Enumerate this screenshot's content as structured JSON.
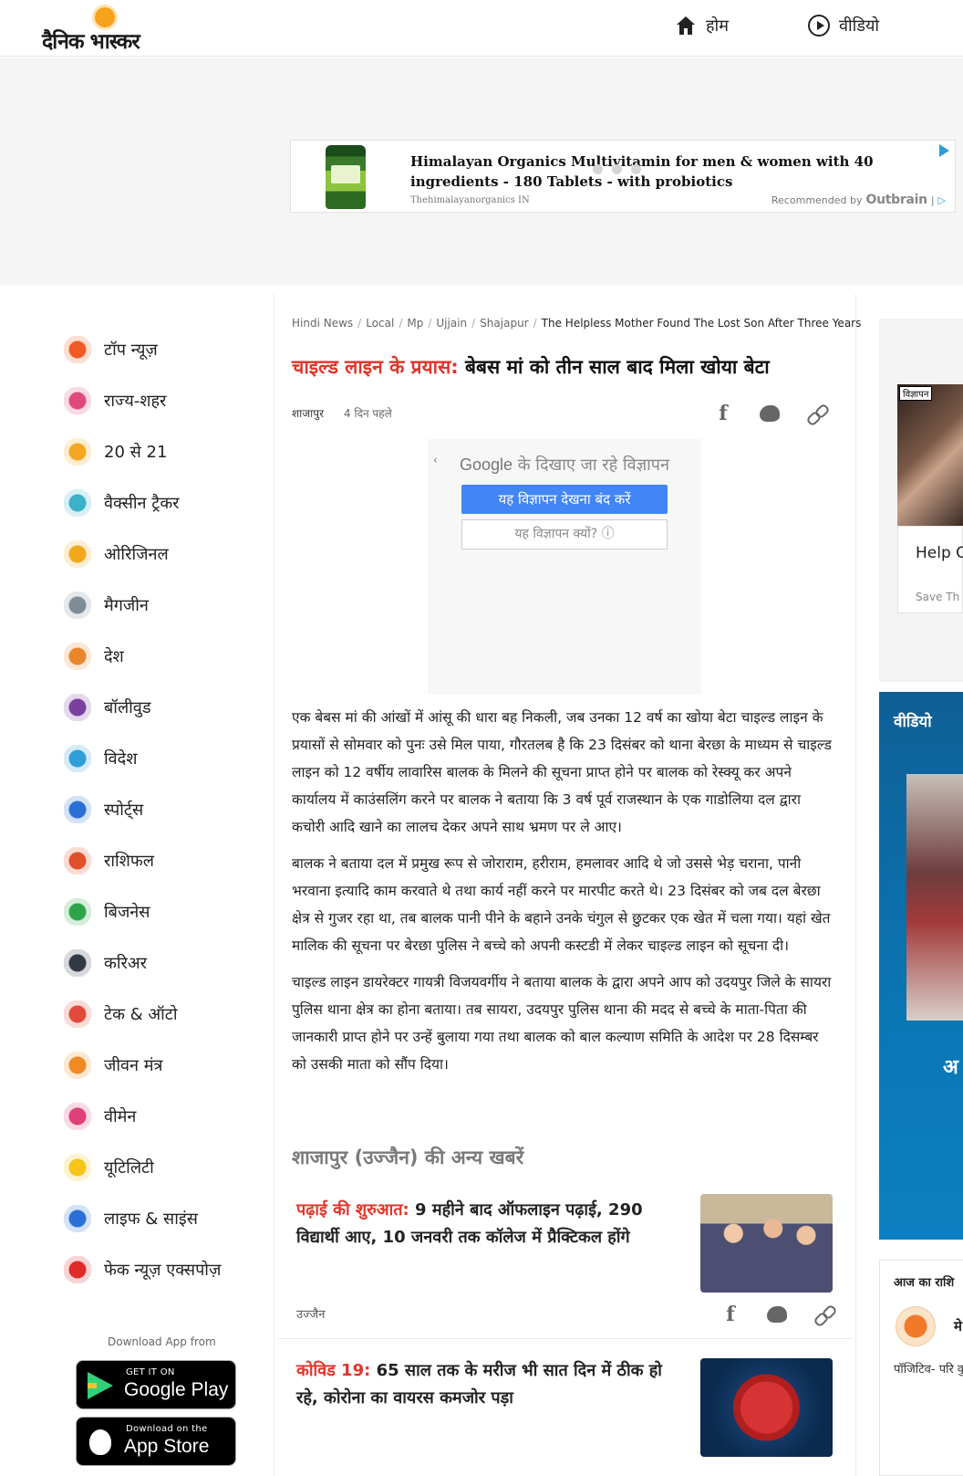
{
  "header": {
    "logo_text": "दैनिक भास्कर",
    "nav": [
      {
        "label": "होम",
        "icon": "home-icon"
      },
      {
        "label": "वीडियो",
        "icon": "play-circle-icon"
      }
    ]
  },
  "top_ad": {
    "title": "Himalayan Organics Multivitamin for men & women with 40 ingredients - 180 Tablets - with probiotics",
    "source": "Thehimalayanorganics IN",
    "recommended_by": "Recommended by",
    "brand": "Outbrain",
    "divider": "|",
    "arrow": "▷"
  },
  "sidebar": {
    "items": [
      {
        "label": "टॉप न्यूज़",
        "icon": "flame-icon",
        "color": "#f15a24"
      },
      {
        "label": "राज्य-शहर",
        "icon": "city-icon",
        "color": "#e04a7a"
      },
      {
        "label": "20 से 21",
        "icon": "sunrise-icon",
        "color": "#f5a623"
      },
      {
        "label": "वैक्सीन ट्रैकर",
        "icon": "syringe-icon",
        "color": "#3bb2c9"
      },
      {
        "label": "ओरिजिनल",
        "icon": "original-badge-icon",
        "color": "#f2a81d"
      },
      {
        "label": "मैगजीन",
        "icon": "magazine-icon",
        "color": "#7e8c99"
      },
      {
        "label": "देश",
        "icon": "india-gate-icon",
        "color": "#e8862d"
      },
      {
        "label": "बॉलीवुड",
        "icon": "clapperboard-icon",
        "color": "#7b3fa0"
      },
      {
        "label": "विदेश",
        "icon": "globe-icon",
        "color": "#2e9fd8"
      },
      {
        "label": "स्पोर्ट्स",
        "icon": "runner-icon",
        "color": "#2a6fd6"
      },
      {
        "label": "राशिफल",
        "icon": "zodiac-icon",
        "color": "#e0502a"
      },
      {
        "label": "बिजनेस",
        "icon": "rupee-coin-icon",
        "color": "#2fa34a"
      },
      {
        "label": "करिअर",
        "icon": "graduation-cap-icon",
        "color": "#333a45"
      },
      {
        "label": "टेक & ऑटो",
        "icon": "car-phone-icon",
        "color": "#e24a3b"
      },
      {
        "label": "जीवन मंत्र",
        "icon": "lotus-lamp-icon",
        "color": "#f08a24"
      },
      {
        "label": "वीमेन",
        "icon": "women-icon",
        "color": "#e0407a"
      },
      {
        "label": "यूटिलिटी",
        "icon": "bulb-icon",
        "color": "#f5c518"
      },
      {
        "label": "लाइफ & साइंस",
        "icon": "dna-icon",
        "color": "#2a6fd6"
      },
      {
        "label": "फेक न्यूज़ एक्सपोज़",
        "icon": "fake-badge-icon",
        "color": "#e02a2a"
      }
    ],
    "download_label": "Download App from",
    "google_play": {
      "small": "GET IT ON",
      "big": "Google Play"
    },
    "app_store": {
      "small": "Download on the",
      "big": "App Store"
    }
  },
  "breadcrumb": [
    "Hindi News",
    "Local",
    "Mp",
    "Ujjain",
    "Shajapur",
    "The Helpless Mother Found The Lost Son After Three Years"
  ],
  "breadcrumb_sep": "/",
  "article": {
    "kicker": "चाइल्ड लाइन के प्रयास:",
    "title": "बेबस मां को तीन साल बाद मिला खोया बेटा",
    "location": "शाजापुर",
    "time": "4 दिन पहले",
    "paragraphs": [
      "एक बेबस मां की आंखों में आंसू की धारा बह निकली, जब उनका 12 वर्ष का खोया बेटा चाइल्ड लाइन के प्रयासों से सोमवार को पुनः उसे मिल पाया, गौरतलब है कि 23 दिसंबर को थाना बेरछा के माध्यम से चाइल्ड लाइन को 12 वर्षीय लावारिस बालक के मिलने की सूचना प्राप्त होने पर बालक को रेस्क्यू कर अपने कार्यालय में काउंसलिंग करने पर बालक ने बताया कि 3 वर्ष पूर्व राजस्थान के एक गाडोलिया दल द्वारा कचोरी आदि खाने का लालच देकर अपने साथ भ्रमण पर ले आए।",
      "बालक ने बताया दल में प्रमुख रूप से जोराराम, हरीराम, हमलावर आदि थे जो उससे भेड़ चराना, पानी भरवाना इत्यादि काम करवाते थे तथा कार्य नहीं करने पर मारपीट करते थे। 23 दिसंबर को जब दल बेरछा क्षेत्र से गुजर रहा था, तब बालक पानी पीने के बहाने उनके चंगुल से छुटकर एक खेत में चला गया। यहां खेत मालिक की सूचना पर बेरछा पुलिस ने बच्चे को अपनी कस्टडी में लेकर चाइल्ड लाइन को सूचना दी।",
      "चाइल्ड लाइन डायरेक्टर गायत्री विजयवर्गीय ने बताया बालक के द्वारा अपने आप को उदयपुर जिले के सायरा पुलिस थाना क्षेत्र का होना बताया। तब सायरा, उदयपुर पुलिस थाना की मदद से बच्चे के माता-पिता की जानकारी प्राप्त होने पर उन्हें बुलाया गया तथा बालक को बाल कल्याण समिति के आदेश पर 28 दिसम्बर को उसकी माता को सौंप दिया।"
    ]
  },
  "google_ad": {
    "back": "‹",
    "brand": "Google",
    "heading": "के दिखाए जा रहे विज्ञापन",
    "stop_button": "यह विज्ञापन देखना बंद करें",
    "why_button": "यह विज्ञापन क्यों? ⓘ"
  },
  "more_news_title": "शाजापुर (उज्जैन) की अन्य खबरें",
  "more_news": [
    {
      "kicker": "पढ़ाई की शुरुआत:",
      "title": "9 महीने बाद ऑफलाइन पढ़ाई, 290 विद्यार्थी आए, 10 जनवरी तक कॉलेज में प्रैक्टिकल होंगे",
      "source": "उज्जैन"
    },
    {
      "kicker": "कोविड 19:",
      "title": "65 साल तक के मरीज भी सात दिन में ठीक हो रहे, कोरोना का वायरस कमजोर पड़ा",
      "source": ""
    }
  ],
  "right_rail": {
    "ad_tag": "विज्ञापन",
    "ad_title": "Help C",
    "ad_sub": "Save Th",
    "video_label": "वीडियो",
    "video_big": "अ",
    "rashi_title": "आज का राशि",
    "rashi_name": "मे",
    "rashi_text": "पॉजिटिव- परि कुछ महत्वपूर्ण आएंगे। पिछले जिंदगी से कुछ भविष्य से संबं"
  },
  "colors": {
    "accent_red": "#e2342a",
    "google_blue": "#4285f4"
  }
}
